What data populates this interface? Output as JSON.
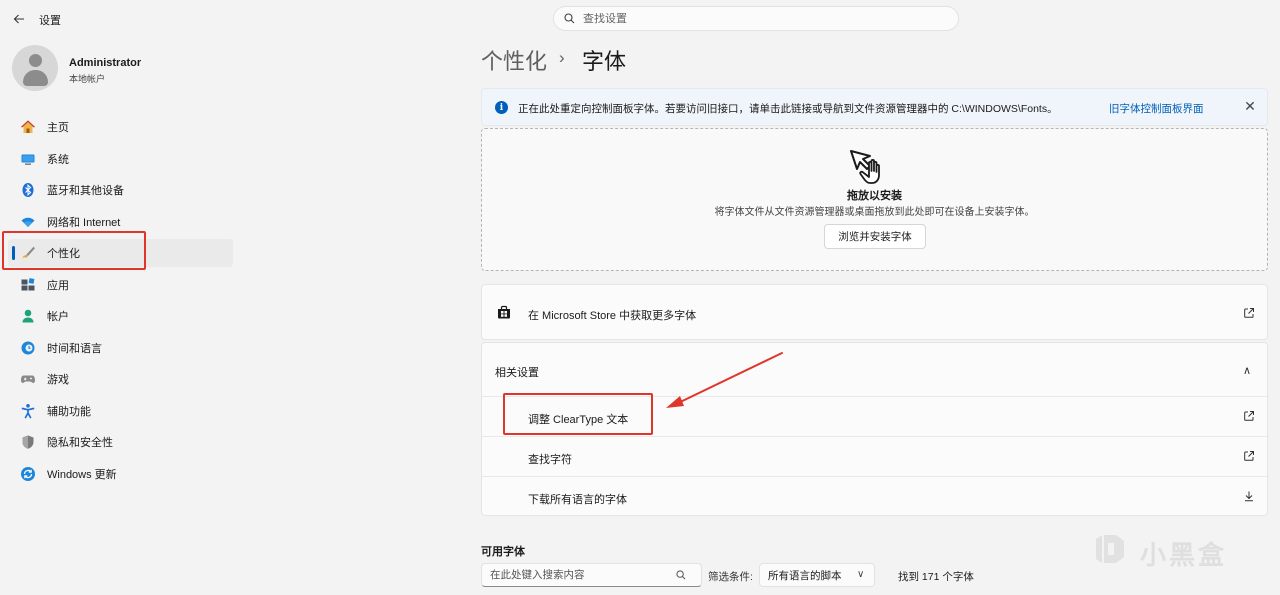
{
  "app": {
    "title": "设置",
    "search_placeholder": "查找设置"
  },
  "profile": {
    "name": "Administrator",
    "account_type": "本地帐户"
  },
  "sidebar": {
    "items": [
      {
        "label": "主页",
        "icon": "home-icon"
      },
      {
        "label": "系统",
        "icon": "system-icon"
      },
      {
        "label": "蓝牙和其他设备",
        "icon": "bluetooth-icon"
      },
      {
        "label": "网络和 Internet",
        "icon": "wifi-icon"
      },
      {
        "label": "个性化",
        "icon": "brush-icon",
        "active": true
      },
      {
        "label": "应用",
        "icon": "apps-icon"
      },
      {
        "label": "帐户",
        "icon": "account-icon"
      },
      {
        "label": "时间和语言",
        "icon": "time-language-icon"
      },
      {
        "label": "游戏",
        "icon": "gaming-icon"
      },
      {
        "label": "辅助功能",
        "icon": "accessibility-icon"
      },
      {
        "label": "隐私和安全性",
        "icon": "shield-icon"
      },
      {
        "label": "Windows 更新",
        "icon": "windows-update-icon"
      }
    ]
  },
  "header": {
    "parent": "个性化",
    "separator": "›",
    "current": "字体"
  },
  "banner": {
    "text": "正在此处重定向控制面板字体。若要访问旧接口，请单击此链接或导航到文件资源管理器中的 C:\\WINDOWS\\Fonts。",
    "link": "旧字体控制面板界面",
    "close": "✕"
  },
  "dropzone": {
    "title": "拖放以安装",
    "subtitle": "将字体文件从文件资源管理器或桌面拖放到此处即可在设备上安装字体。",
    "button": "浏览并安装字体"
  },
  "store": {
    "label": "在 Microsoft Store 中获取更多字体"
  },
  "related": {
    "title": "相关设置",
    "chevron": "∧",
    "rows": [
      {
        "label": "调整 ClearType 文本",
        "icon": "external-link-icon"
      },
      {
        "label": "查找字符",
        "icon": "external-link-icon"
      },
      {
        "label": "下载所有语言的字体",
        "icon": "download-icon"
      }
    ]
  },
  "available": {
    "title": "可用字体",
    "search_placeholder": "在此处键入搜索内容",
    "filter_label": "筛选条件:",
    "filter_value": "所有语言的脚本",
    "found": "找到 171 个字体"
  },
  "watermark": {
    "text": "小黑盒"
  },
  "colors": {
    "accent": "#005fb8",
    "annotation_red": "#e0352b",
    "background": "#f3f3f3"
  }
}
